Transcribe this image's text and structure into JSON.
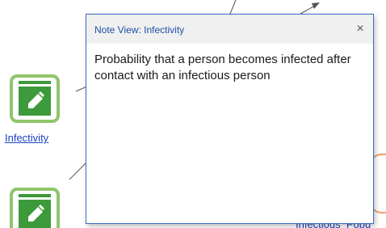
{
  "diagram": {
    "nodes": [
      {
        "label": "Infectivity"
      },
      {
        "label": ""
      }
    ],
    "partial_label": "Infectious_Popu"
  },
  "note_view": {
    "title": "Note View: Infectivity",
    "close_glyph": "×",
    "text": "Probability that a person becomes infected after contact with an infectious person"
  },
  "colors": {
    "window_border": "#3a6dc4",
    "title_text": "#1f4fa8",
    "link_text": "#1a45c2",
    "node_border": "#8fc56b",
    "node_fill": "#3d9a3a",
    "flow_node_border": "#f2a06b"
  },
  "icons": {
    "node_icon": "pencil-note-icon",
    "close_icon": "close-icon"
  }
}
